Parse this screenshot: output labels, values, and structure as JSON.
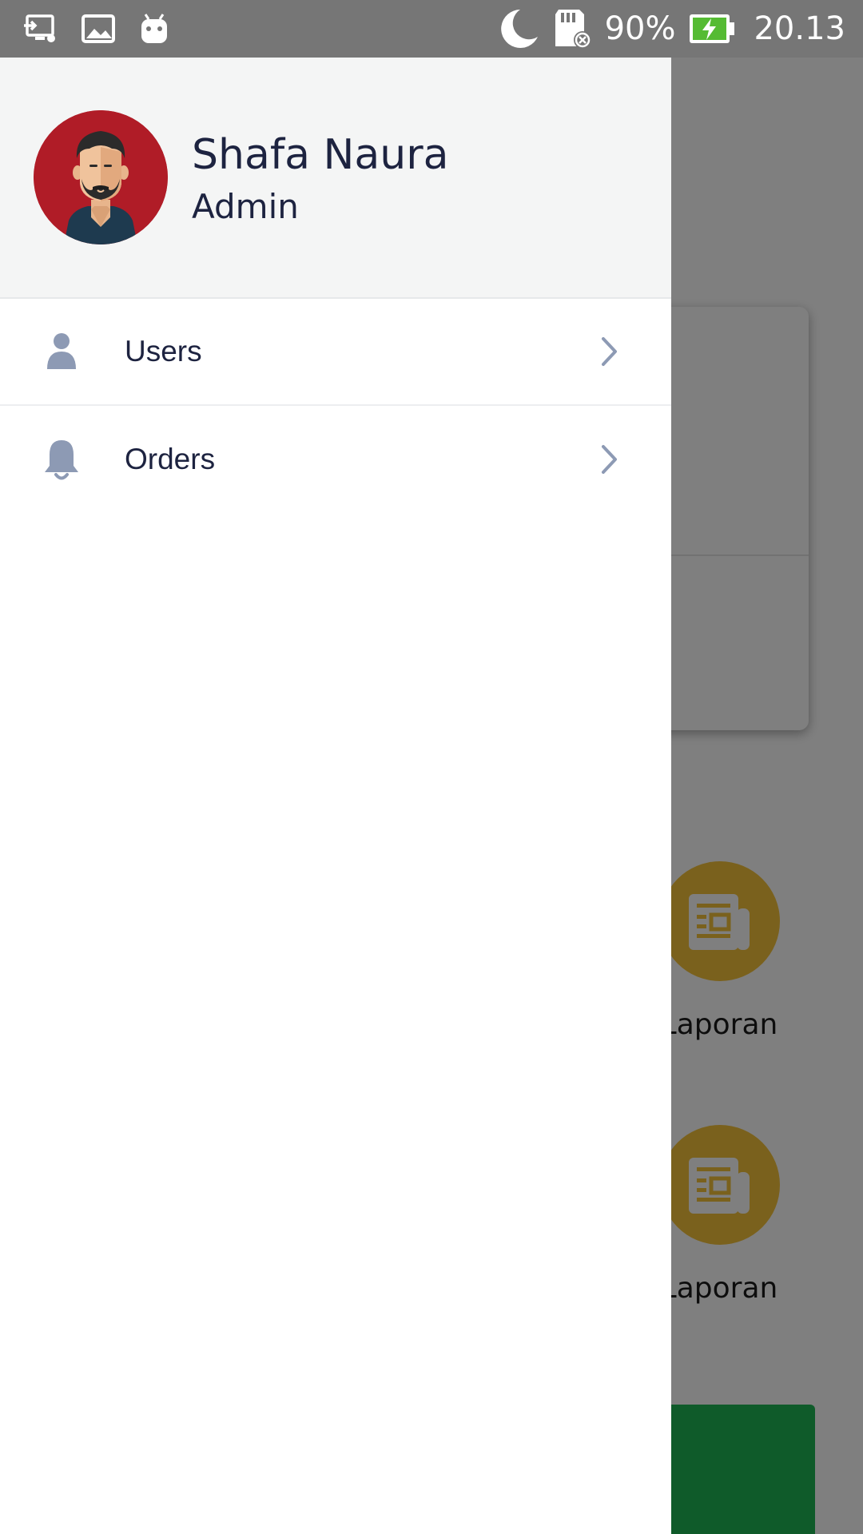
{
  "status_bar": {
    "battery_percent": "90%",
    "time": "20.13",
    "icons": [
      "cast-icon",
      "image-icon",
      "android-icon",
      "moon-icon",
      "sd-card-error-icon",
      "battery-charging-icon"
    ]
  },
  "drawer": {
    "user": {
      "name": "Shafa Naura",
      "role": "Admin",
      "avatar_icon": "avatar-man-beard"
    },
    "items": [
      {
        "label": "Users",
        "icon": "person-icon"
      },
      {
        "label": "Orders",
        "icon": "bell-icon"
      }
    ]
  },
  "background": {
    "menu_labels": [
      "Laporan",
      "Laporan"
    ],
    "menu_icon": "newspaper-icon",
    "colors": {
      "menu_circle": "#f5c23a",
      "green_button": "#1fb655"
    }
  },
  "colors": {
    "icon_muted": "#8d9ab4",
    "text_dark": "#1d2340",
    "avatar_bg": "#b01c27"
  }
}
